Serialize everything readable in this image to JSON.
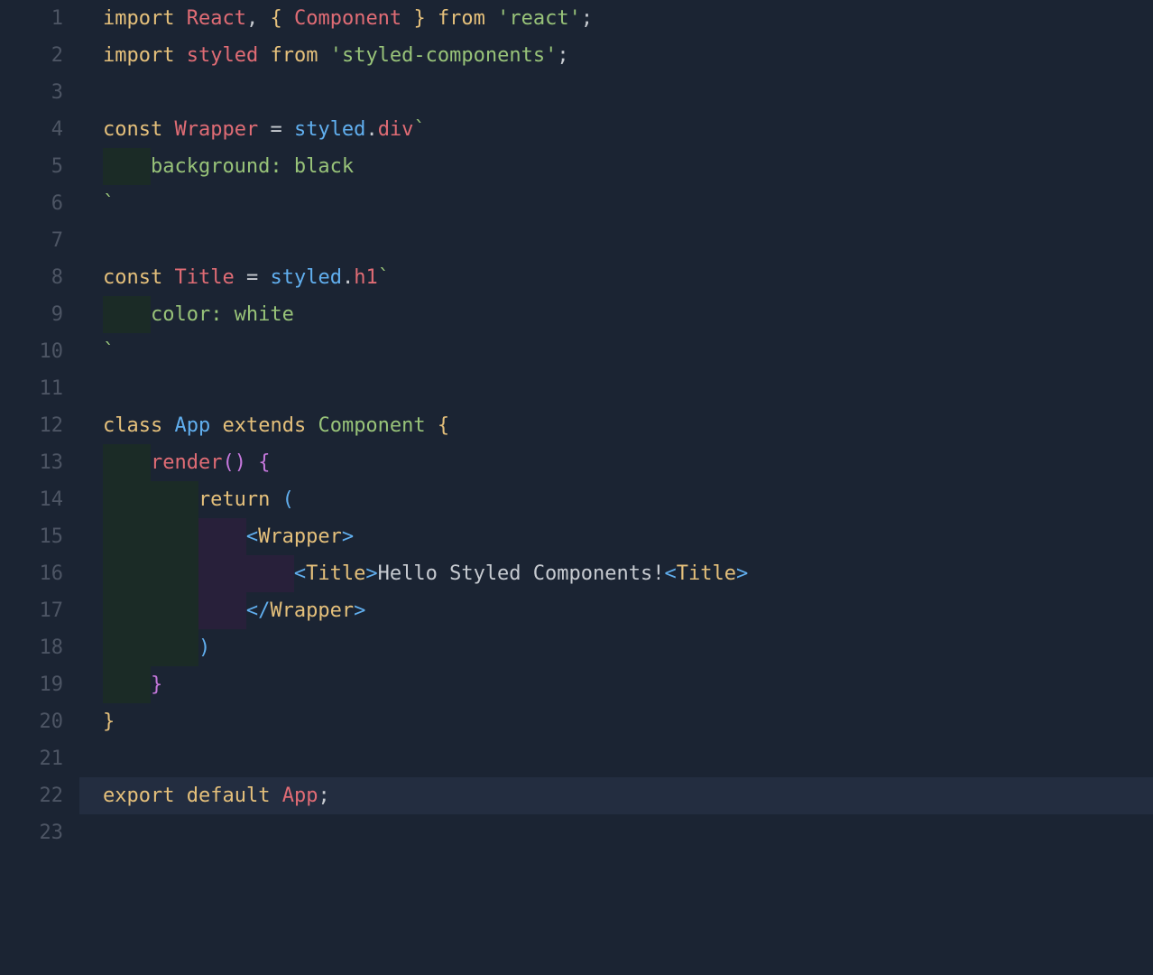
{
  "line_numbers": [
    "1",
    "2",
    "3",
    "4",
    "5",
    "6",
    "7",
    "8",
    "9",
    "10",
    "11",
    "12",
    "13",
    "14",
    "15",
    "16",
    "17",
    "18",
    "19",
    "20",
    "21",
    "22",
    "23"
  ],
  "code": {
    "l1": {
      "kw1": "import",
      "id1": "React",
      "comma": ",",
      "lb": "{",
      "id2": "Component",
      "rb": "}",
      "kw2": "from",
      "str": "'react'",
      "semi": ";"
    },
    "l2": {
      "kw1": "import",
      "id1": "styled",
      "kw2": "from",
      "str": "'styled-components'",
      "semi": ";"
    },
    "l4": {
      "kw": "const",
      "id": "Wrapper",
      "eq": "=",
      "obj": "styled",
      "dot": ".",
      "prop": "div",
      "tick": "`"
    },
    "l5": {
      "css": "background: black"
    },
    "l6": {
      "tick": "`"
    },
    "l8": {
      "kw": "const",
      "id": "Title",
      "eq": "=",
      "obj": "styled",
      "dot": ".",
      "prop": "h1",
      "tick": "`"
    },
    "l9": {
      "css": "color: white"
    },
    "l10": {
      "tick": "`"
    },
    "l12": {
      "kw1": "class",
      "name": "App",
      "kw2": "extends",
      "sup": "Component",
      "lb": "{"
    },
    "l13": {
      "fn": "render",
      "paren": "()",
      "lb": "{"
    },
    "l14": {
      "kw": "return",
      "lp": "("
    },
    "l15": {
      "lt": "<",
      "tag": "Wrapper",
      "gt": ">"
    },
    "l16": {
      "lt1": "<",
      "tag1": "Title",
      "gt1": ">",
      "text": "Hello Styled Components!",
      "lt2": "<",
      "tag2": "Title",
      "gt2": ">"
    },
    "l17": {
      "lt": "</",
      "tag": "Wrapper",
      "gt": ">"
    },
    "l18": {
      "rp": ")"
    },
    "l19": {
      "rb": "}"
    },
    "l20": {
      "rb": "}"
    },
    "l22": {
      "kw1": "export",
      "kw2": "default",
      "id": "App",
      "semi": ";"
    }
  }
}
